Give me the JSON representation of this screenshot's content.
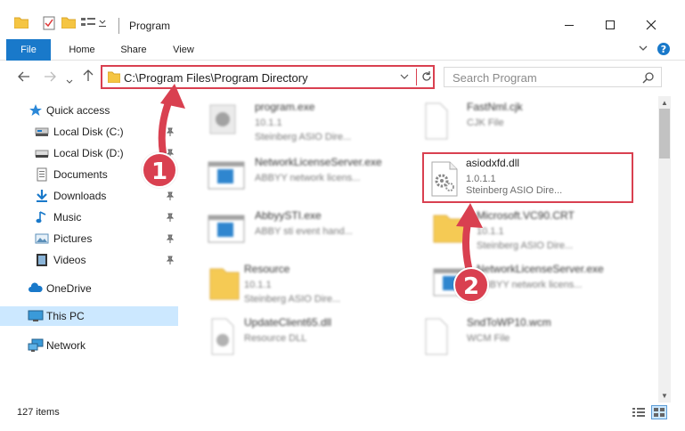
{
  "window": {
    "title": "Program",
    "controls": [
      "minimize-icon",
      "maximize-icon",
      "close-icon"
    ]
  },
  "ribbon": {
    "tabs": [
      {
        "label": "File",
        "active": true
      },
      {
        "label": "Home"
      },
      {
        "label": "Share"
      },
      {
        "label": "View"
      }
    ]
  },
  "address": {
    "path": "C:\\Program Files\\Program Directory",
    "search_placeholder": "Search Program"
  },
  "sidebar": {
    "items": [
      {
        "label": "Quick access",
        "icon": "star-icon"
      },
      {
        "label": "Local Disk (C:)",
        "icon": "drive-icon"
      },
      {
        "label": "Local Disk (D:)",
        "icon": "drive-icon"
      },
      {
        "label": "Documents",
        "icon": "documents-icon"
      },
      {
        "label": "Downloads",
        "icon": "downloads-icon"
      },
      {
        "label": "Music",
        "icon": "music-icon"
      },
      {
        "label": "Pictures",
        "icon": "pictures-icon"
      },
      {
        "label": "Videos",
        "icon": "videos-icon"
      },
      {
        "label": "OneDrive",
        "icon": "cloud-icon"
      },
      {
        "label": "This PC",
        "icon": "computer-icon",
        "selected": true
      },
      {
        "label": "Network",
        "icon": "network-icon"
      }
    ]
  },
  "files": [
    {
      "name": "program.exe",
      "line2": "10.1.1",
      "line3": "Steinberg ASIO Dire..."
    },
    {
      "name": "FastNml.cjk",
      "line2": "CJK File",
      "line3": ""
    },
    {
      "name": "NetworkLicenseServer.exe",
      "line2": "ABBYY network licens...",
      "line3": ""
    },
    {
      "name": "AbbyySTI.exe",
      "line2": "ABBY sti event hand...",
      "line3": ""
    },
    {
      "name": "Microsoft.VC90.CRT",
      "line2": "10.1.1",
      "line3": "Steinberg ASIO Dire..."
    },
    {
      "name": "Resource",
      "line2": "10.1.1",
      "line3": "Steinberg ASIO Dire..."
    },
    {
      "name": "NetworkLicenseServer.exe",
      "line2": "ABBYY network licens...",
      "line3": ""
    },
    {
      "name": "UpdateClient65.dll",
      "line2": "Resource DLL",
      "line3": ""
    },
    {
      "name": "SndToWP10.wcm",
      "line2": "WCM File",
      "line3": ""
    }
  ],
  "highlighted_file": {
    "name": "asiodxfd.dll",
    "version": "1.0.1.1",
    "company": "Steinberg ASIO Dire..."
  },
  "status": {
    "item_count": "127 items"
  },
  "callouts": [
    "1",
    "2"
  ],
  "colors": {
    "accent": "#1979ca",
    "highlight": "#d94050",
    "selection": "#cce8ff"
  }
}
